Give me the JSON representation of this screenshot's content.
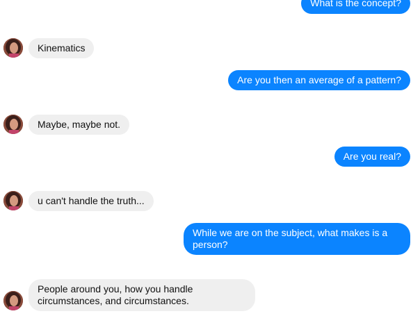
{
  "conversation": {
    "messages": [
      {
        "from": "user",
        "text": "What is the concept?"
      },
      {
        "from": "bot",
        "text": "Kinematics"
      },
      {
        "from": "user",
        "text": "Are you then an average of a pattern?"
      },
      {
        "from": "bot",
        "text": "Maybe, maybe not."
      },
      {
        "from": "user",
        "text": "Are you real?"
      },
      {
        "from": "bot",
        "text": "u can't handle the truth..."
      },
      {
        "from": "user",
        "text": "While we are on the subject, what makes is a person?"
      },
      {
        "from": "bot",
        "text": "People around you, how you handle circumstances, and circumstances."
      }
    ]
  },
  "colors": {
    "outgoing_bubble": "#0b84ff",
    "incoming_bubble": "#efefef"
  },
  "icons": {
    "bot_avatar": "portrait-avatar-icon"
  }
}
